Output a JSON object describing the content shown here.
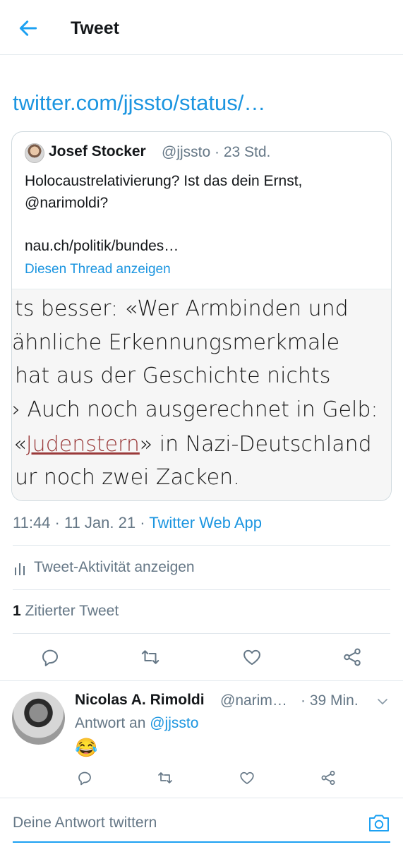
{
  "header": {
    "title": "Tweet"
  },
  "tweet": {
    "link_text": "twitter.com/jjssto/status/…",
    "quote": {
      "name": "Josef Stocker",
      "handle": "@jjssto",
      "time": "· 23 Std.",
      "text": "Holocaustrelativierung? Ist das dein Ernst, @narimoldi?",
      "url": "nau.ch/politik/bundes…",
      "show_thread": "Diesen Thread anzeigen",
      "image_lines": [
        "ts besser: «Wer Armbinden und",
        "ähnliche Erkennungsmerkmale",
        "hat aus der Geschichte nichts",
        "› Auch noch ausgerechnet in Gelb:",
        "ur noch zwei Zacken."
      ],
      "image_line5": {
        "pre": "«",
        "link": "Judenstern",
        "post": "» in Nazi-Deutschland"
      }
    },
    "timestamp": "11:44 · 11 Jan. 21 · ",
    "source": "Twitter Web App",
    "activity": "Tweet-Aktivität anzeigen",
    "quoted_count": "1",
    "quoted_label": "Zitierter Tweet"
  },
  "reply": {
    "name": "Nicolas A. Rimoldi",
    "handle": "@narim…",
    "time": "· 39 Min.",
    "reply_to_label": "Antwort an ",
    "reply_to_handle": "@jjssto",
    "emoji": "😂"
  },
  "composer": {
    "placeholder": "Deine Antwort twittern"
  },
  "colors": {
    "accent": "#1da1f2",
    "muted": "#657786",
    "divider": "#e1e8ed"
  }
}
